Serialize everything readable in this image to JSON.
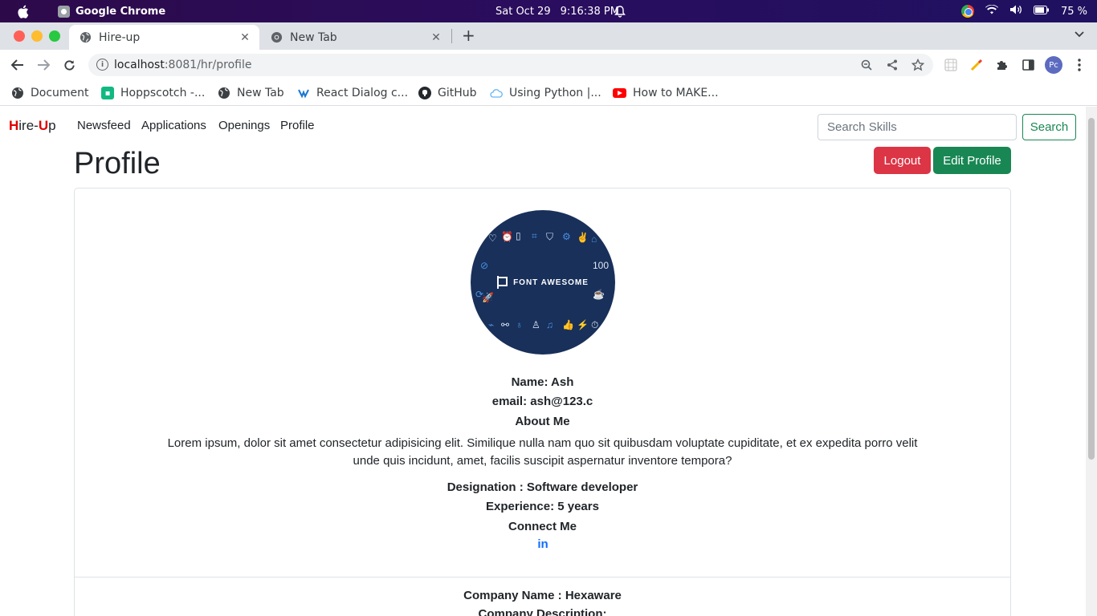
{
  "os_bar": {
    "app_name": "Google Chrome",
    "date": "Sat Oct 29",
    "time": "9:16:38 PM",
    "battery": "75 %"
  },
  "tabs": [
    {
      "title": "Hire-up",
      "active": true
    },
    {
      "title": "New Tab",
      "active": false
    }
  ],
  "toolbar": {
    "url_host": "localhost",
    "url_rest": ":8081/hr/profile",
    "profile_initials": "Pc"
  },
  "bookmarks": [
    {
      "label": "Document",
      "icon": "globe-icon"
    },
    {
      "label": "Hoppscotch -...",
      "icon": "hoppscotch-icon"
    },
    {
      "label": "New Tab",
      "icon": "globe-icon"
    },
    {
      "label": "React Dialog c...",
      "icon": "react-icon"
    },
    {
      "label": "GitHub",
      "icon": "github-icon"
    },
    {
      "label": "Using Python |...",
      "icon": "cloud-icon"
    },
    {
      "label": "How to MAKE...",
      "icon": "youtube-icon"
    }
  ],
  "navbar": {
    "brand_h": "H",
    "brand_mid": "ire-",
    "brand_u": "U",
    "brand_end": "p",
    "links": [
      "Newsfeed",
      "Applications",
      "Openings",
      "Profile"
    ],
    "search_placeholder": "Search Skills",
    "search_button": "Search"
  },
  "page": {
    "title": "Profile",
    "logout_label": "Logout",
    "edit_label": "Edit Profile"
  },
  "profile": {
    "avatar_text": "FONT AWESOME",
    "name": "Name: Ash",
    "email": "email: ash@123.c",
    "about_heading": "About Me",
    "about_text": "Lorem ipsum, dolor sit amet consectetur adipisicing elit. Similique nulla nam quo sit quibusdam voluptate cupiditate, et ex expedita porro velit unde quis incidunt, amet, facilis suscipit aspernatur inventore tempora?",
    "designation": "Designation : Software developer",
    "experience": "Experience: 5 years",
    "connect_heading": "Connect Me",
    "linkedin_label": "in",
    "company_name": "Company Name : Hexaware",
    "company_description": "Company Description:"
  },
  "colors": {
    "danger": "#dc3545",
    "success": "#198754",
    "brand_red": "#e00000",
    "link_blue": "#0d6efd"
  }
}
